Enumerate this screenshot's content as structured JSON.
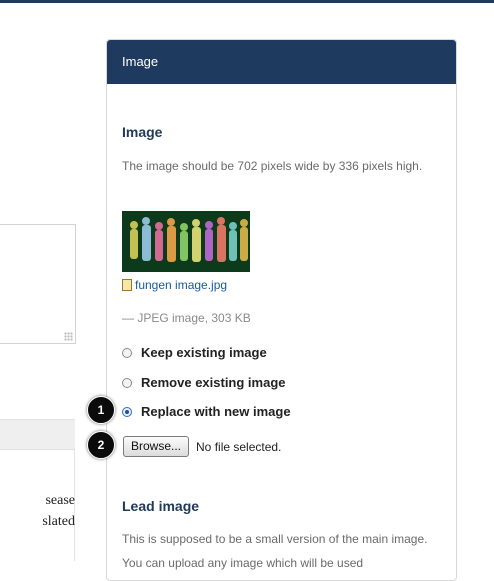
{
  "panel": {
    "header": "Image",
    "image_section": {
      "title": "Image",
      "help": "The image should be 702 pixels wide by 336 pixels high.",
      "file_name": "fungen image.jpg",
      "file_meta": "— JPEG image, 303 KB"
    },
    "options": [
      {
        "label": "Keep existing image",
        "checked": false
      },
      {
        "label": "Remove existing image",
        "checked": false
      },
      {
        "label": "Replace with new image",
        "checked": true
      }
    ],
    "upload": {
      "browse_label": "Browse...",
      "status": "No file selected."
    },
    "lead_section": {
      "title": "Lead image",
      "help": "This is supposed to be a small version of the main image. You can upload any image which will be used"
    }
  },
  "left": {
    "text": "sease\nslated"
  },
  "badges": [
    "1",
    "2"
  ],
  "colors": {
    "header_bg": "#1f3a5f",
    "title": "#213a5a",
    "link": "#1a5a9a"
  }
}
